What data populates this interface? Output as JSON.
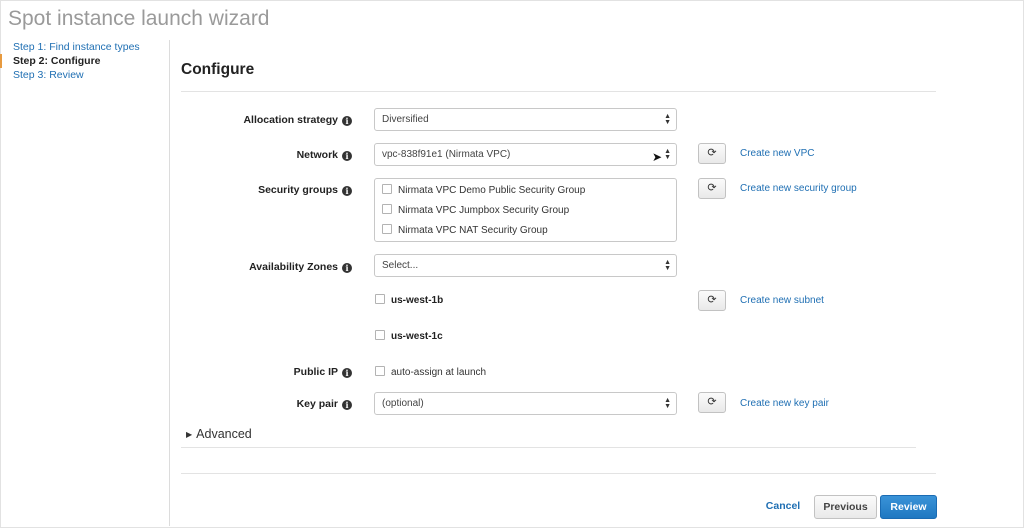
{
  "header": {
    "title": "Spot instance launch wizard"
  },
  "steps": [
    {
      "label": "Step 1: Find instance types"
    },
    {
      "label": "Step 2: Configure"
    },
    {
      "label": "Step 3: Review"
    }
  ],
  "section": {
    "title": "Configure"
  },
  "form": {
    "allocation_strategy": {
      "label": "Allocation strategy",
      "value": "Diversified"
    },
    "network": {
      "label": "Network",
      "value": "vpc-838f91e1 (Nirmata VPC)",
      "link": "Create new VPC"
    },
    "security_groups": {
      "label": "Security groups",
      "options": [
        "Nirmata VPC Demo Public Security Group",
        "Nirmata VPC Jumpbox Security Group",
        "Nirmata VPC NAT Security Group"
      ],
      "link": "Create new security group"
    },
    "availability_zones": {
      "label": "Availability Zones",
      "placeholder": "Select...",
      "zones": [
        "us-west-1b",
        "us-west-1c"
      ],
      "link": "Create new subnet"
    },
    "public_ip": {
      "label": "Public IP",
      "option": "auto-assign at launch"
    },
    "key_pair": {
      "label": "Key pair",
      "value": "(optional)",
      "link": "Create new key pair"
    }
  },
  "advanced": {
    "label": "Advanced"
  },
  "footer": {
    "cancel": "Cancel",
    "previous": "Previous",
    "review": "Review"
  },
  "icons": {
    "info": "i",
    "refresh": "⟳"
  },
  "colors": {
    "link": "#1f6fb3",
    "primary_button": "#1f78c2",
    "active_step_marker": "#e79a3f"
  }
}
